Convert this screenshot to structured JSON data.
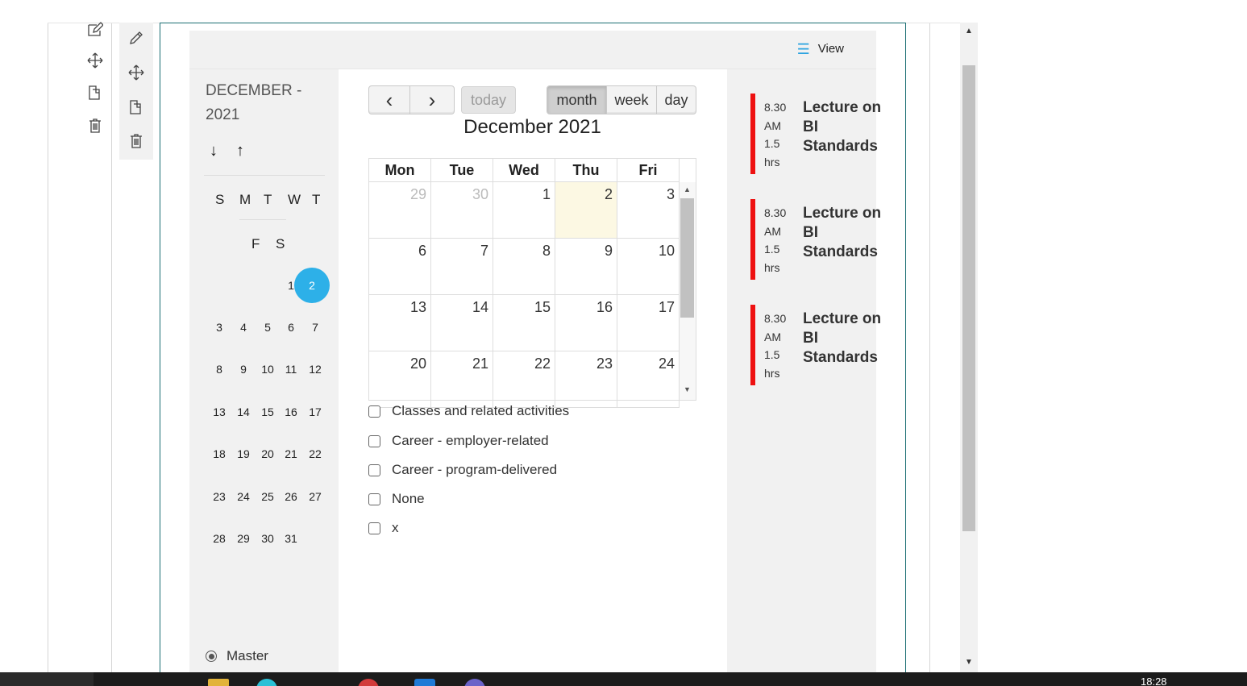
{
  "editor_toolbar": {
    "outer_icons": [
      "edit-icon",
      "move-icon",
      "copy-icon",
      "trash-icon"
    ],
    "inner_icons": [
      "pencil-icon",
      "move-icon",
      "copy-icon",
      "trash-icon"
    ]
  },
  "header": {
    "view_label": "View"
  },
  "mini_calendar": {
    "title": "DECEMBER - 2021",
    "down_arrow": "↓",
    "up_arrow": "↑",
    "dow_row1": [
      "S",
      "M",
      "T",
      "W",
      "T"
    ],
    "dow_row2": [
      "F",
      "S"
    ],
    "row0": [
      "1",
      "2"
    ],
    "weeks": [
      [
        "3",
        "4",
        "5",
        "6",
        "7"
      ],
      [
        "8",
        "9",
        "10",
        "11",
        "12"
      ],
      [
        "13",
        "14",
        "15",
        "16",
        "17"
      ],
      [
        "18",
        "19",
        "20",
        "21",
        "22"
      ],
      [
        "23",
        "24",
        "25",
        "26",
        "27"
      ],
      [
        "28",
        "29",
        "30",
        "31"
      ]
    ],
    "selected_day": "2",
    "radio_label": "Master"
  },
  "calendar": {
    "prev": "‹",
    "next": "›",
    "today_label": "today",
    "views": [
      "month",
      "week",
      "day"
    ],
    "active_view": "month",
    "title": "December 2021",
    "headers": [
      "Mon",
      "Tue",
      "Wed",
      "Thu",
      "Fri"
    ],
    "weeks": [
      [
        "29",
        "30",
        "1",
        "2",
        "3"
      ],
      [
        "6",
        "7",
        "8",
        "9",
        "10"
      ],
      [
        "13",
        "14",
        "15",
        "16",
        "17"
      ],
      [
        "20",
        "21",
        "22",
        "23",
        "24"
      ]
    ],
    "today_cell": "2"
  },
  "filters": [
    "Classes and related activities",
    "Career - employer-related",
    "Career - program-delivered",
    "None",
    "x"
  ],
  "events": [
    {
      "time_lines": [
        "8.30",
        "AM",
        "1.5",
        "hrs"
      ],
      "title": "Lecture on BI Standards"
    },
    {
      "time_lines": [
        "8.30",
        "AM",
        "1.5",
        "hrs"
      ],
      "title": "Lecture on BI Standards"
    },
    {
      "time_lines": [
        "8.30",
        "AM",
        "1.5",
        "hrs"
      ],
      "title": "Lecture on BI Standards"
    }
  ],
  "colors": {
    "accent": "#2db0e8",
    "event_bar": "#ee1111",
    "frame_border": "#1b6e73",
    "today_bg": "#fcf8e3"
  },
  "taskbar": {
    "clock": "18:28"
  }
}
